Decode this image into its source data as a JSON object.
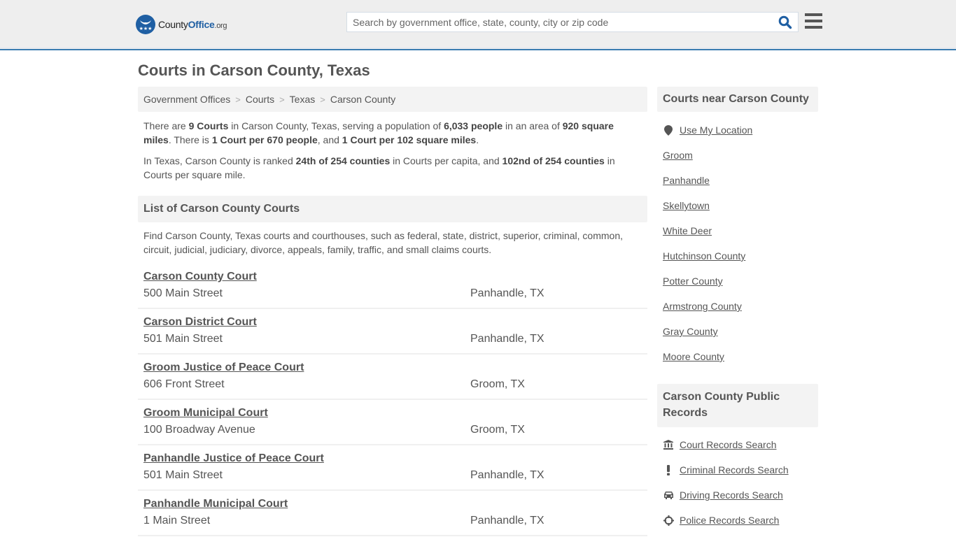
{
  "header": {
    "logo": {
      "brand_main": "County",
      "brand_accent": "Office",
      "brand_suffix": ".org"
    },
    "search": {
      "placeholder": "Search by government office, state, county, city or zip code",
      "value": ""
    },
    "colors": {
      "accent": "#3a7cb0",
      "brand": "#1f5fa3",
      "header_bg": "#eeeeee"
    }
  },
  "page": {
    "title": "Courts in Carson County, Texas",
    "breadcrumb": [
      "Government Offices",
      "Courts",
      "Texas",
      "Carson County"
    ],
    "intro1": {
      "t1": "There are ",
      "b1": "9 Courts",
      "t2": " in Carson County, Texas, serving a population of ",
      "b2": "6,033 people",
      "t3": " in an area of ",
      "b3": "920 square miles",
      "t4": ". There is ",
      "b4": "1 Court per 670 people",
      "t5": ", and ",
      "b5": "1 Court per 102 square miles",
      "t6": "."
    },
    "intro2": {
      "t1": "In Texas, Carson County is ranked ",
      "b1": "24th of 254 counties",
      "t2": " in Courts per capita, and ",
      "b2": "102nd of 254 counties",
      "t3": " in Courts per square mile."
    },
    "list_title": "List of Carson County Courts",
    "list_desc": "Find Carson County, Texas courts and courthouses, such as federal, state, district, superior, criminal, common, circuit, judicial, judiciary, divorce, appeals, family, traffic, and small claims courts.",
    "courts": [
      {
        "name": "Carson County Court",
        "address": "500 Main Street",
        "city": "Panhandle, TX"
      },
      {
        "name": "Carson District Court",
        "address": "501 Main Street",
        "city": "Panhandle, TX"
      },
      {
        "name": "Groom Justice of Peace Court",
        "address": "606 Front Street",
        "city": "Groom, TX"
      },
      {
        "name": "Groom Municipal Court",
        "address": "100 Broadway Avenue",
        "city": "Groom, TX"
      },
      {
        "name": "Panhandle Justice of Peace Court",
        "address": "501 Main Street",
        "city": "Panhandle, TX"
      },
      {
        "name": "Panhandle Municipal Court",
        "address": "1 Main Street",
        "city": "Panhandle, TX"
      }
    ]
  },
  "sidebar": {
    "nearby_title": "Courts near Carson County",
    "use_location": "Use My Location",
    "nearby": [
      "Groom",
      "Panhandle",
      "Skellytown",
      "White Deer",
      "Hutchinson County",
      "Potter County",
      "Armstrong County",
      "Gray County",
      "Moore County"
    ],
    "records_title": "Carson County Public Records",
    "records": [
      {
        "label": "Court Records Search",
        "icon": "courthouse-icon"
      },
      {
        "label": "Criminal Records Search",
        "icon": "exclamation-icon"
      },
      {
        "label": "Driving Records Search",
        "icon": "car-icon"
      },
      {
        "label": "Police Records Search",
        "icon": "crosshair-icon"
      }
    ]
  }
}
